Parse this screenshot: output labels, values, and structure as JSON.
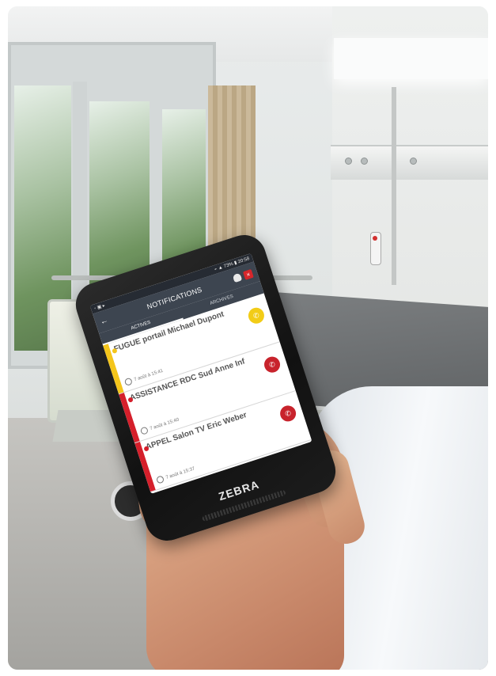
{
  "phone": {
    "status_left": "◦ ▣ ▸",
    "status_right": "⌁ ▲ 73% ▮ 20:58",
    "app_title": "NOTIFICATIONS",
    "back_glyph": "←",
    "close_glyph": "×",
    "tabs": [
      {
        "label": "ACTIVES",
        "active": true
      },
      {
        "label": "ARCHIVES",
        "active": false
      }
    ],
    "alerts": [
      {
        "name": "FUGUE portail Michael Dupont",
        "time": "7 août à 15:41",
        "color": "#f4c51b",
        "action_color": "#f2cc17"
      },
      {
        "name": "ASSISTANCE RDC Sud Anne Inf",
        "time": "7 août à 15:40",
        "color": "#d51f2b",
        "action_color": "#c8232c"
      },
      {
        "name": "APPEL Salon TV Eric Weber",
        "time": "7 août à 15:37",
        "color": "#d51f2b",
        "action_color": "#c8232c"
      }
    ],
    "brand": "ZEBRA",
    "icons": [
      "back-arrow-icon",
      "bell-icon",
      "close-icon",
      "clock-icon",
      "phone-call-icon"
    ]
  }
}
